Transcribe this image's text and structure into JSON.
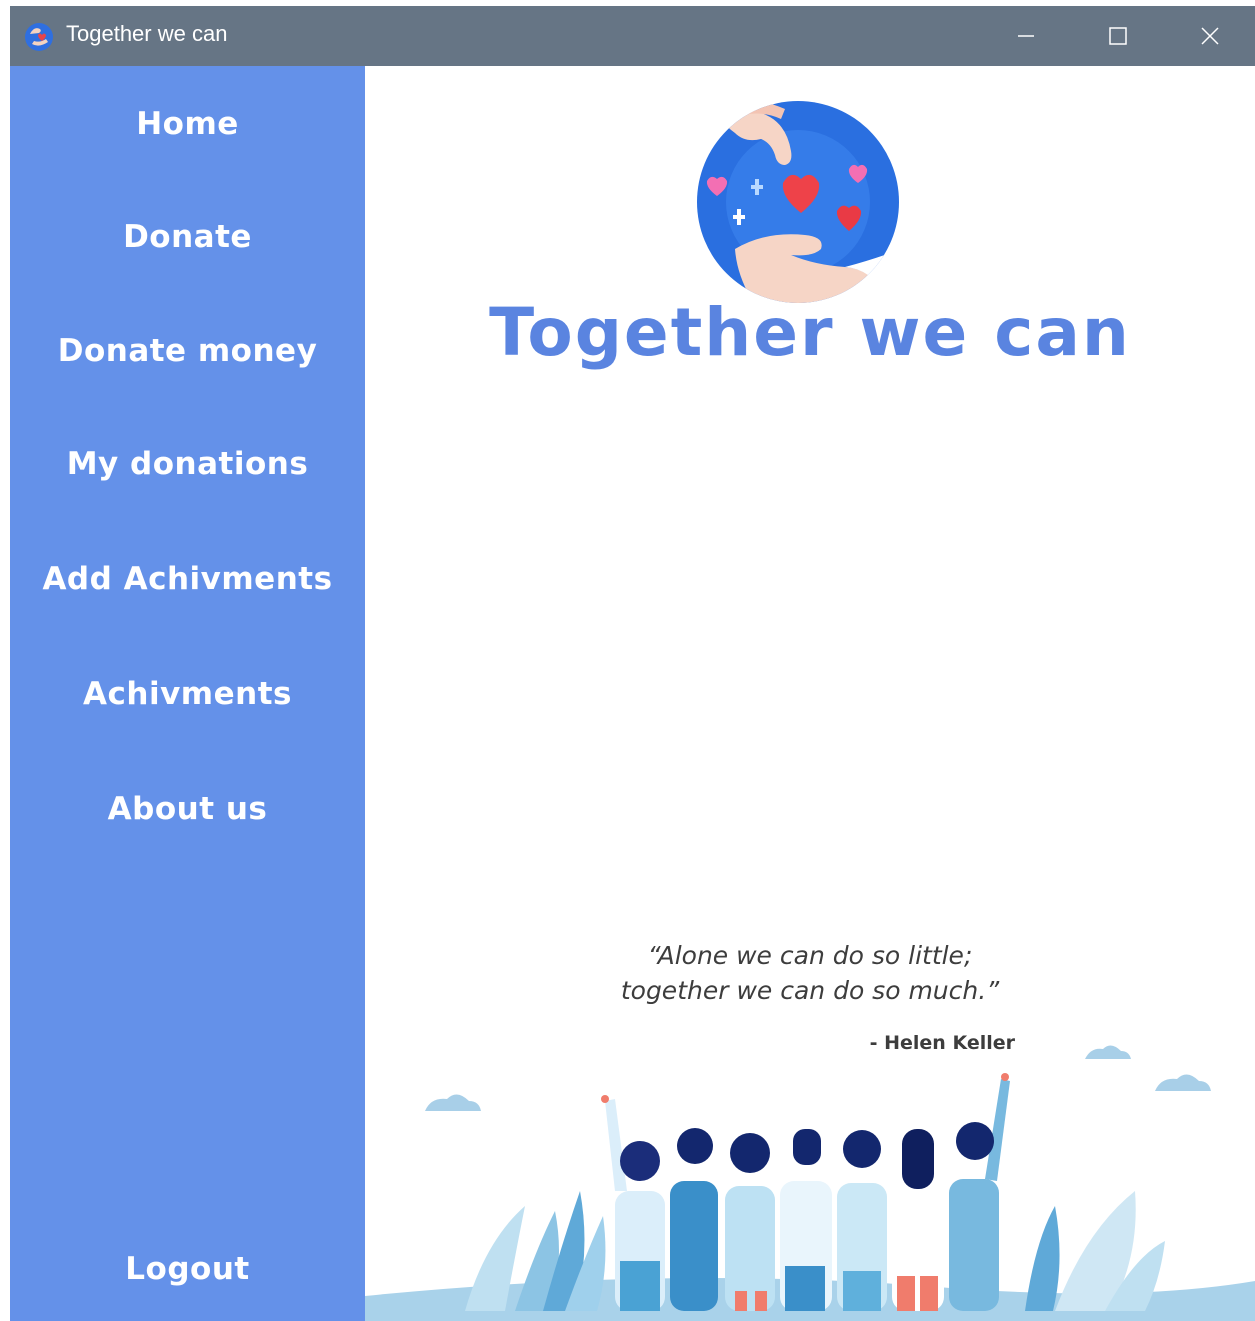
{
  "window": {
    "title": "Together we can",
    "icon": "app-logo-icon",
    "controls": [
      "minimize-icon",
      "maximize-icon",
      "close-icon"
    ]
  },
  "sidebar": {
    "background": "#6491e9",
    "items": [
      {
        "label": "Home"
      },
      {
        "label": "Donate"
      },
      {
        "label": "Donate money"
      },
      {
        "label": "My donations"
      },
      {
        "label": "Add Achivments"
      },
      {
        "label": "Achivments"
      },
      {
        "label": "About us"
      }
    ],
    "logout_label": "Logout"
  },
  "main": {
    "brand_title": "Together we can",
    "brand_color": "#5a84e0",
    "logo_icon": "heart-giving-hands-icon",
    "quote": {
      "line1": "“Alone we can do so little;",
      "line2": "together we can do so much.”",
      "author": "- Helen Keller"
    },
    "illustration": "group-of-people-embracing-illustration"
  },
  "colors": {
    "titlebar": "#667585",
    "accent": "#6491e9"
  }
}
